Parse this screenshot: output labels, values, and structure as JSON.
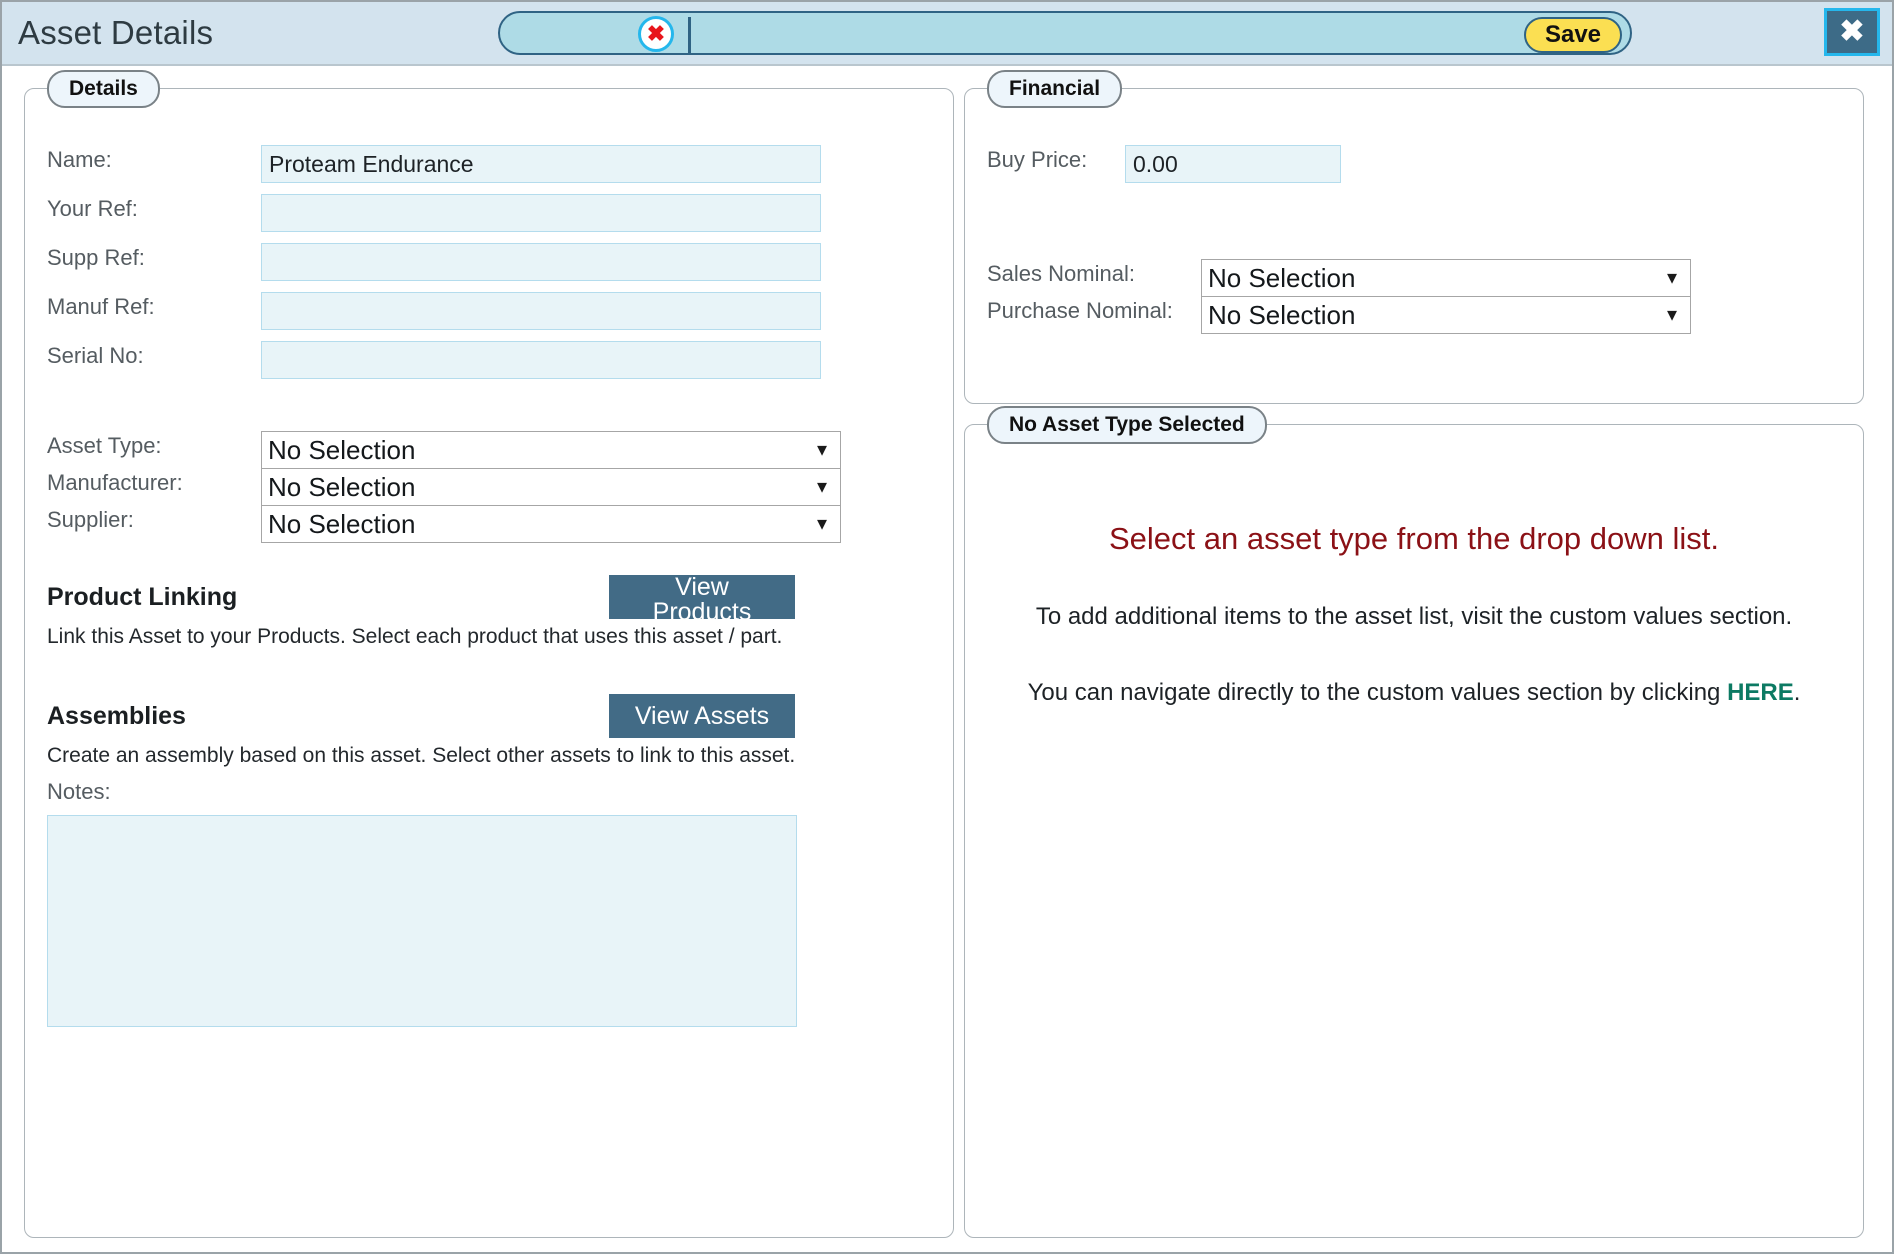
{
  "titlebar": {
    "title": "Asset Details",
    "clear_icon": "close-x-icon",
    "search_value": "",
    "search_placeholder": "",
    "save_label": "Save",
    "close_label": "✖"
  },
  "details": {
    "legend": "Details",
    "fields": [
      {
        "label": "Name:",
        "value": "Proteam Endurance"
      },
      {
        "label": "Your Ref:",
        "value": ""
      },
      {
        "label": "Supp Ref:",
        "value": ""
      },
      {
        "label": "Manuf Ref:",
        "value": ""
      },
      {
        "label": "Serial No:",
        "value": ""
      }
    ],
    "selects": [
      {
        "label": "Asset Type:",
        "value": "No Selection"
      },
      {
        "label": "Manufacturer:",
        "value": "No Selection"
      },
      {
        "label": "Supplier:",
        "value": "No Selection"
      }
    ],
    "product_linking": {
      "heading": "Product Linking",
      "description": "Link this Asset to your Products. Select each product that uses this asset / part.",
      "button": "View Products"
    },
    "assemblies": {
      "heading": "Assemblies",
      "description": "Create an assembly based on this asset. Select other assets to link to this asset.",
      "button": "View Assets"
    },
    "notes": {
      "label": "Notes:",
      "value": ""
    }
  },
  "financial": {
    "legend": "Financial",
    "buy_price_label": "Buy Price:",
    "buy_price_value": "0.00",
    "sales_nominal_label": "Sales Nominal:",
    "sales_nominal_value": "No Selection",
    "purchase_nominal_label": "Purchase Nominal:",
    "purchase_nominal_value": "No Selection"
  },
  "asset_type": {
    "legend": "No Asset Type Selected",
    "message": "Select an asset type from the drop down list.",
    "info_line_1": "To add additional items to the asset list, visit the custom values section.",
    "info_line_2_prefix": "You can navigate directly to the custom values section by clicking ",
    "info_link": "HERE",
    "info_line_2_suffix": "."
  },
  "colors": {
    "titlebar_bg": "#d3e3ee",
    "pill_bg": "#aedbe6",
    "pill_border": "#2f6384",
    "save_bg": "#fbdf52",
    "close_bg": "#3d6b87",
    "close_border": "#25b7ec",
    "input_bg": "#e8f4f8",
    "input_border": "#b4dced",
    "button_bg": "#426b86",
    "warning_text": "#8b1116",
    "link_text": "#0c7a63",
    "legend_bg": "#edf5fb"
  }
}
